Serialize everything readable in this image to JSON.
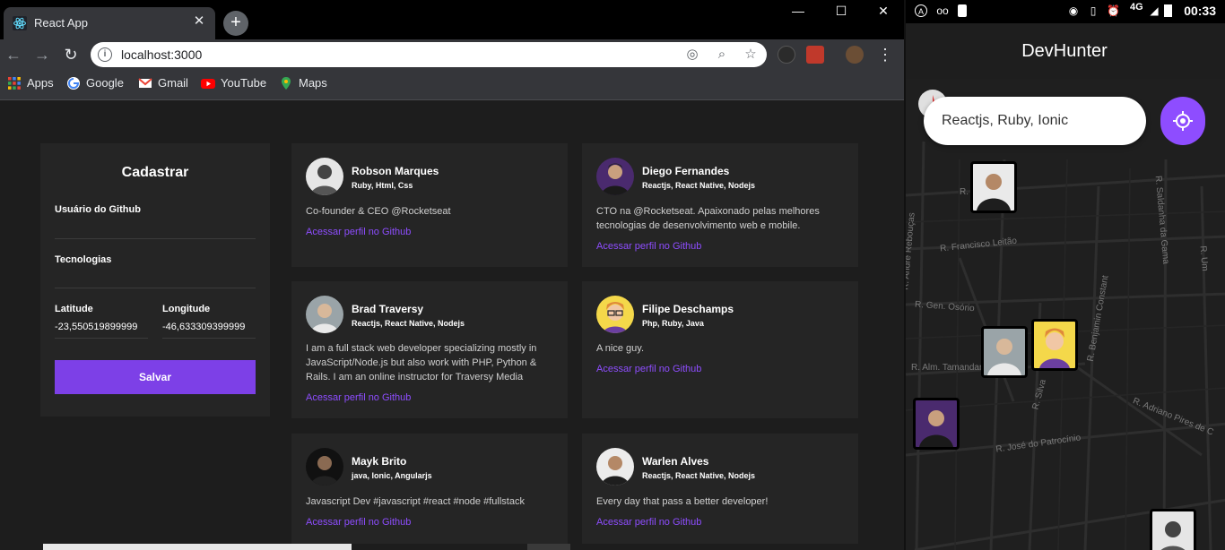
{
  "browser": {
    "tab_title": "React App",
    "url": "localhost:3000",
    "bookmarks": [
      {
        "label": "Apps",
        "icon": "apps-grid-icon"
      },
      {
        "label": "Google",
        "icon": "google-icon"
      },
      {
        "label": "Gmail",
        "icon": "gmail-icon"
      },
      {
        "label": "YouTube",
        "icon": "youtube-icon"
      },
      {
        "label": "Maps",
        "icon": "maps-icon"
      }
    ]
  },
  "form": {
    "title": "Cadastrar",
    "github_label": "Usuário do Github",
    "github_value": "",
    "techs_label": "Tecnologias",
    "techs_value": "",
    "lat_label": "Latitude",
    "lat_value": "-23,550519899999",
    "lng_label": "Longitude",
    "lng_value": "-46,633309399999",
    "save_label": "Salvar"
  },
  "devs": [
    {
      "name": "Robson Marques",
      "techs": "Ruby, Html, Css",
      "bio": "Co-founder & CEO @Rocketseat",
      "link": "Acessar perfil no Github"
    },
    {
      "name": "Diego Fernandes",
      "techs": "Reactjs, React Native, Nodejs",
      "bio": "CTO na @Rocketseat. Apaixonado pelas melhores tecnologias de desenvolvimento web e mobile.",
      "link": "Acessar perfil no Github"
    },
    {
      "name": "Brad Traversy",
      "techs": "Reactjs, React Native, Nodejs",
      "bio": "I am a full stack web developer specializing mostly in JavaScript/Node.js but also work with PHP, Python & Rails. I am an online instructor for Traversy Media",
      "link": "Acessar perfil no Github"
    },
    {
      "name": "Filipe Deschamps",
      "techs": "Php, Ruby, Java",
      "bio": "A nice guy.",
      "link": "Acessar perfil no Github"
    },
    {
      "name": "Mayk Brito",
      "techs": "java, Ionic, Angularjs",
      "bio": "Javascript Dev #javascript #react #node #fullstack",
      "link": "Acessar perfil no Github"
    },
    {
      "name": "Warlen Alves",
      "techs": "Reactjs, React Native, Nodejs",
      "bio": "Every day that pass a better developer!",
      "link": "Acessar perfil no Github"
    }
  ],
  "phone": {
    "time": "00:33",
    "network": "4G",
    "app_title": "DevHunter",
    "search_value": "Reactjs, Ruby, Ionic",
    "streets": [
      "R. Pascais",
      "R. Francisco Leitão",
      "R. Gen. Osório",
      "R. Alm. Tamandaré",
      "R. André Rebouças",
      "R. Saldanha da Gama",
      "R. Benjamin Constant",
      "R. Silva",
      "R. Adriano Pires de C",
      "R. José do Patrocínio",
      "R. Um"
    ]
  },
  "colors": {
    "accent": "#7d40e7",
    "link": "#8e4dff",
    "page_bg": "#1d1d1d",
    "card_bg": "#252525"
  }
}
